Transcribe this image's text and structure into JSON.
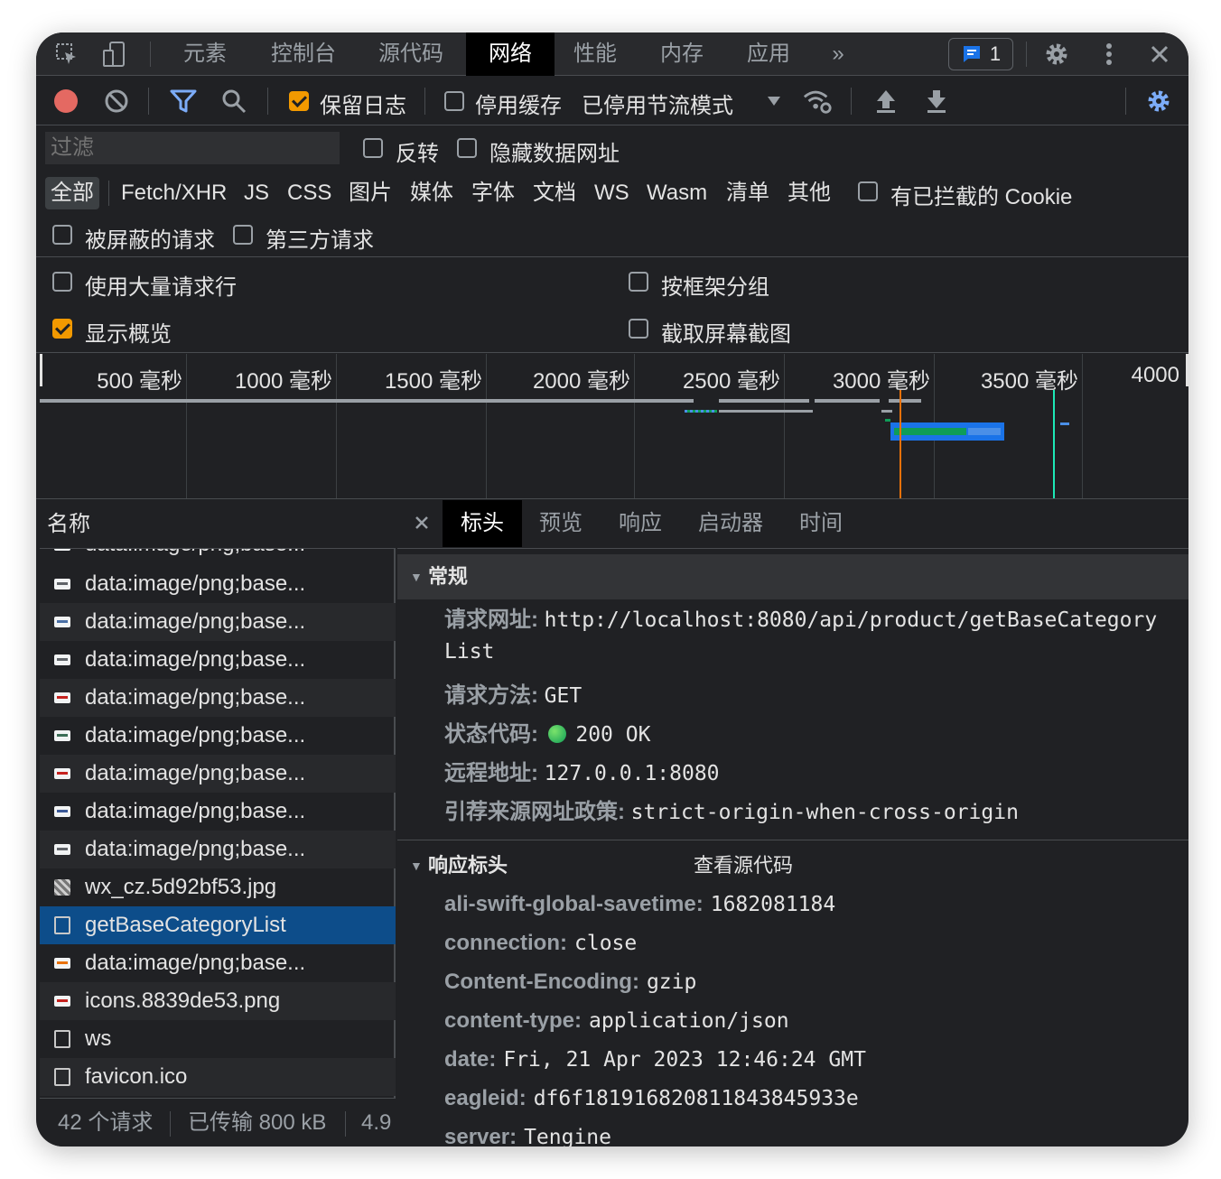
{
  "tabbar": {
    "tabs": [
      "元素",
      "控制台",
      "源代码",
      "网络",
      "性能",
      "内存",
      "应用"
    ],
    "active_tab": "网络",
    "more": "»",
    "messages_count": "1"
  },
  "toolbar": {
    "preserve_log_label": "保留日志",
    "preserve_log_checked": true,
    "disable_cache_label": "停用缓存",
    "disable_cache_checked": false,
    "throttling_value": "已停用节流模式"
  },
  "filter": {
    "placeholder": "过滤",
    "invert_label": "反转",
    "hide_data_urls_label": "隐藏数据网址",
    "types": [
      "全部",
      "Fetch/XHR",
      "JS",
      "CSS",
      "图片",
      "媒体",
      "字体",
      "文档",
      "WS",
      "Wasm",
      "清单",
      "其他"
    ],
    "active_type": "全部",
    "blocked_cookies_label": "有已拦截的 Cookie",
    "blocked_requests_label": "被屏蔽的请求",
    "third_party_label": "第三方请求"
  },
  "settings": {
    "big_rows_label": "使用大量请求行",
    "group_by_frame_label": "按框架分组",
    "show_overview_label": "显示概览",
    "show_overview_checked": true,
    "capture_screenshots_label": "截取屏幕截图"
  },
  "overview": {
    "ticks": [
      "500 毫秒",
      "1000 毫秒",
      "1500 毫秒",
      "2000 毫秒",
      "2500 毫秒",
      "3000 毫秒",
      "3500 毫秒",
      "4000"
    ]
  },
  "request_list": {
    "header": "名称",
    "rows": [
      {
        "name": "data:image/png;base...",
        "icon": "image",
        "color": "#5f6368"
      },
      {
        "name": "data:image/png;base...",
        "icon": "image",
        "color": "#4a6fa5"
      },
      {
        "name": "data:image/png;base...",
        "icon": "image",
        "color": "#5f6368"
      },
      {
        "name": "data:image/png;base...",
        "icon": "image",
        "color": "#c5221f"
      },
      {
        "name": "data:image/png;base...",
        "icon": "image",
        "color": "#3c6e57"
      },
      {
        "name": "data:image/png;base...",
        "icon": "image",
        "color": "#c5221f"
      },
      {
        "name": "data:image/png;base...",
        "icon": "image",
        "color": "#3b5998"
      },
      {
        "name": "data:image/png;base...",
        "icon": "image",
        "color": "#5f6368"
      },
      {
        "name": "wx_cz.5d92bf53.jpg",
        "icon": "photo",
        "color": "#808080"
      },
      {
        "name": "getBaseCategoryList",
        "icon": "doc",
        "color": ""
      },
      {
        "name": "data:image/png;base...",
        "icon": "image",
        "color": "#e8710a"
      },
      {
        "name": "icons.8839de53.png",
        "icon": "image",
        "color": "#c5221f"
      },
      {
        "name": "ws",
        "icon": "doc",
        "color": ""
      },
      {
        "name": "favicon.ico",
        "icon": "doc",
        "color": ""
      }
    ],
    "partial_row": "data:image/png;base...",
    "selected_index": 9,
    "status": {
      "requests": "42 个请求",
      "transferred": "已传输 800 kB",
      "resources": "4.9"
    }
  },
  "details": {
    "tabs": [
      "标头",
      "预览",
      "响应",
      "启动器",
      "时间"
    ],
    "active_tab": "标头",
    "general": {
      "title": "常规",
      "request_url_key": "请求网址:",
      "request_url_value": "http://localhost:8080/api/product/getBaseCategory",
      "request_url_value_cont": "List",
      "method_key": "请求方法:",
      "method_value": "GET",
      "status_key": "状态代码:",
      "status_value": "200 OK",
      "remote_key": "远程地址:",
      "remote_value": "127.0.0.1:8080",
      "referrer_key": "引荐来源网址政策:",
      "referrer_value": "strict-origin-when-cross-origin"
    },
    "response_headers": {
      "title": "响应标头",
      "view_source": "查看源代码",
      "items": [
        {
          "key": "ali-swift-global-savetime:",
          "value": "1682081184"
        },
        {
          "key": "connection:",
          "value": "close"
        },
        {
          "key": "Content-Encoding:",
          "value": "gzip"
        },
        {
          "key": "content-type:",
          "value": "application/json"
        },
        {
          "key": "date:",
          "value": "Fri, 21 Apr 2023 12:46:24 GMT"
        },
        {
          "key": "eagleid:",
          "value": "df6f181916820811843845933e"
        },
        {
          "key": "server:",
          "value": "Tengine"
        }
      ]
    }
  },
  "colors": {
    "selected_row": "#0d4d8a",
    "accent_checkbox": "#f29900",
    "record_red": "#e46962",
    "filter_blue": "#7cacf8",
    "status_green": "#0f9d58"
  }
}
